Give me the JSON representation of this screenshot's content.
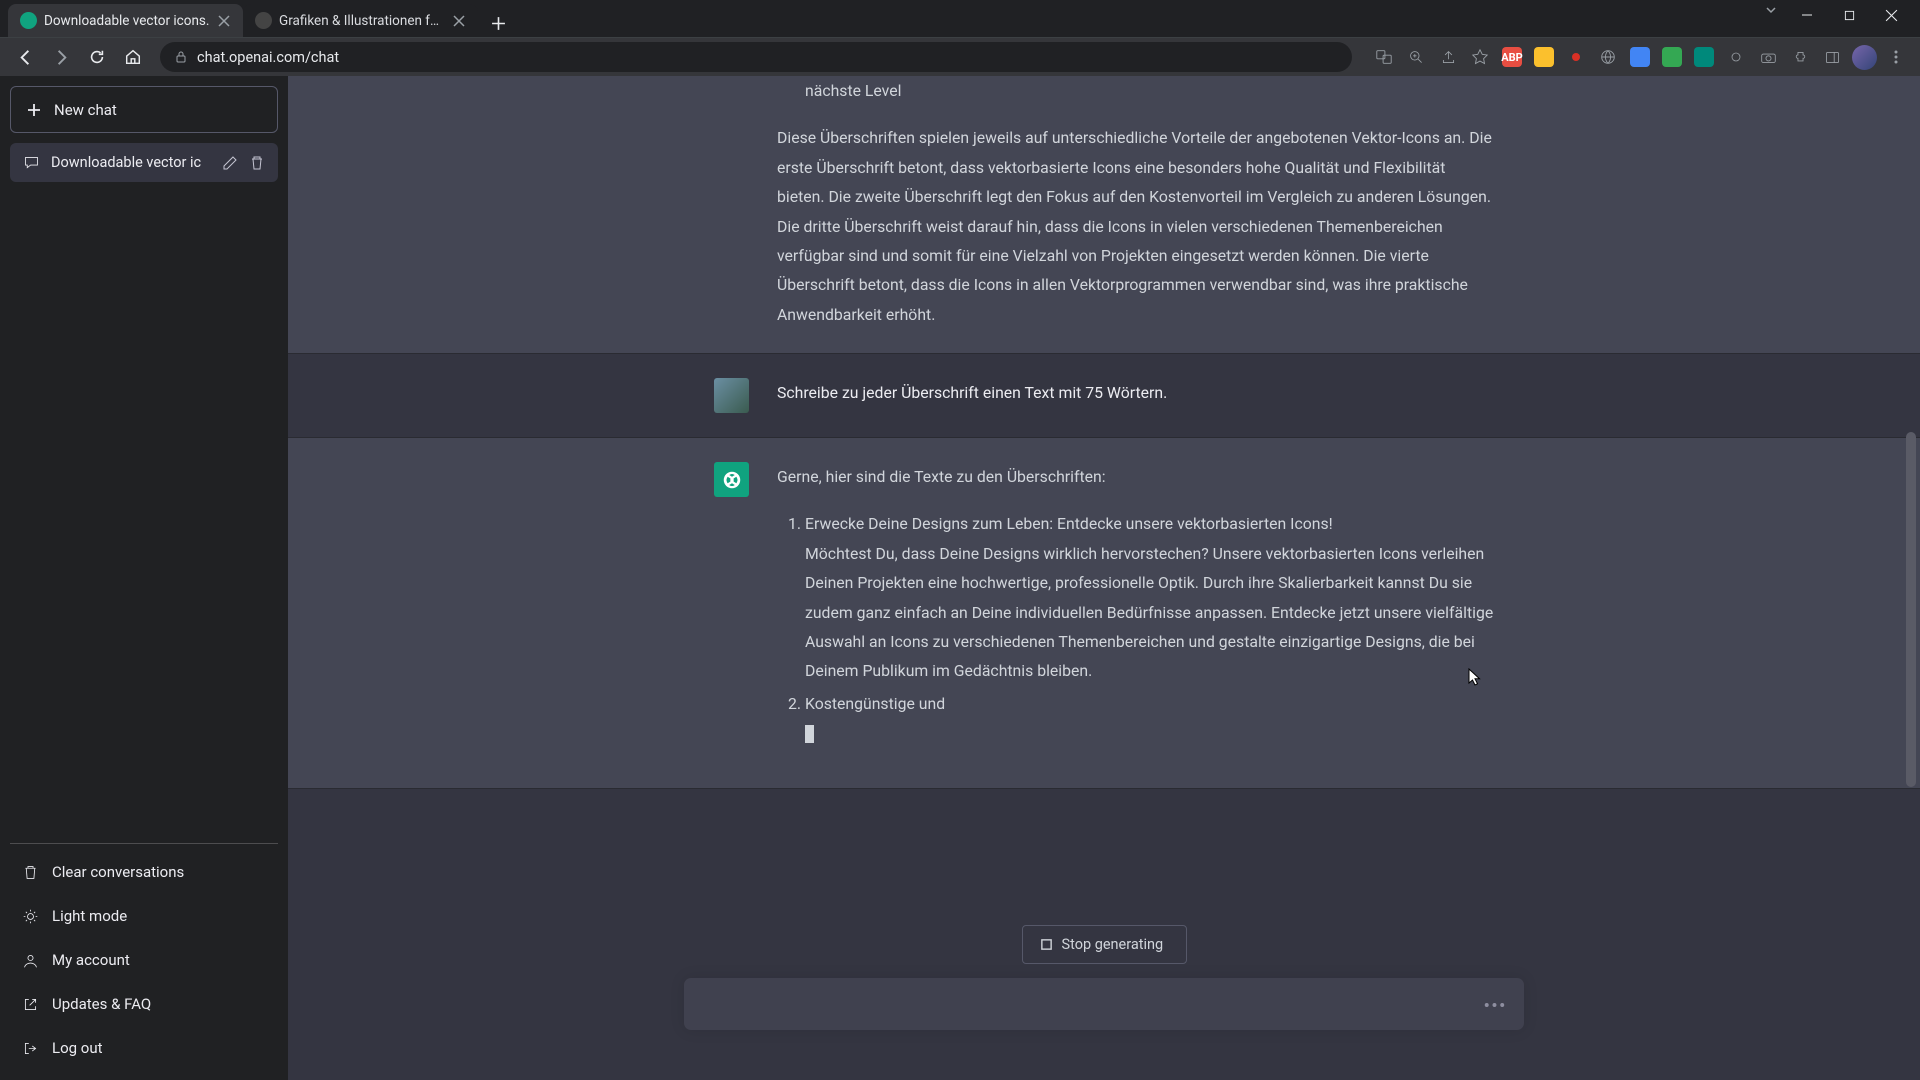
{
  "browser": {
    "tabs": [
      {
        "title": "Downloadable vector icons.",
        "active": true,
        "favicon_color": "#10a37f"
      },
      {
        "title": "Grafiken & Illustrationen für Vek",
        "active": false,
        "favicon_color": "#444444"
      }
    ],
    "url": "chat.openai.com/chat"
  },
  "sidebar": {
    "newchat_label": "New chat",
    "active_chat": "Downloadable vector ic",
    "footer_items": [
      {
        "id": "clear",
        "label": "Clear conversations"
      },
      {
        "id": "light",
        "label": "Light mode"
      },
      {
        "id": "account",
        "label": "My account"
      },
      {
        "id": "faq",
        "label": "Updates & FAQ"
      },
      {
        "id": "logout",
        "label": "Log out"
      }
    ]
  },
  "messages": {
    "assist1_trailing_fragment": "nächste Level",
    "assist1_paragraph": "Diese Überschriften spielen jeweils auf unterschiedliche Vorteile der angebotenen Vektor-Icons an. Die erste Überschrift betont, dass vektorbasierte Icons eine besonders hohe Qualität und Flexibilität bieten. Die zweite Überschrift legt den Fokus auf den Kostenvorteil im Vergleich zu anderen Lösungen. Die dritte Überschrift weist darauf hin, dass die Icons in vielen verschiedenen Themenbereichen verfügbar sind und somit für eine Vielzahl von Projekten eingesetzt werden können. Die vierte Überschrift betont, dass die Icons in allen Vektorprogrammen verwendbar sind, was ihre praktische Anwendbarkeit erhöht.",
    "user_prompt": "Schreibe zu jeder Überschrift einen Text mit 75 Wörtern.",
    "assist2_intro": "Gerne, hier sind die Texte zu den Überschriften:",
    "assist2_item1_title": "Erwecke Deine Designs zum Leben: Entdecke unsere vektorbasierten Icons!",
    "assist2_item1_body": "Möchtest Du, dass Deine Designs wirklich hervorstechen? Unsere vektorbasierten Icons verleihen Deinen Projekten eine hochwertige, professionelle Optik. Durch ihre Skalierbarkeit kannst Du sie zudem ganz einfach an Deine individuellen Bedürfnisse anpassen. Entdecke jetzt unsere vielfältige Auswahl an Icons zu verschiedenen Themenbereichen und gestalte einzigartige Designs, die bei Deinem Publikum im Gedächtnis bleiben.",
    "assist2_item2_partial": "Kostengünstige und"
  },
  "composer": {
    "stop_label": "Stop generating",
    "placeholder": ""
  },
  "colors": {
    "abp_red": "#e84e42",
    "yellow_ext": "#fbc02d"
  }
}
